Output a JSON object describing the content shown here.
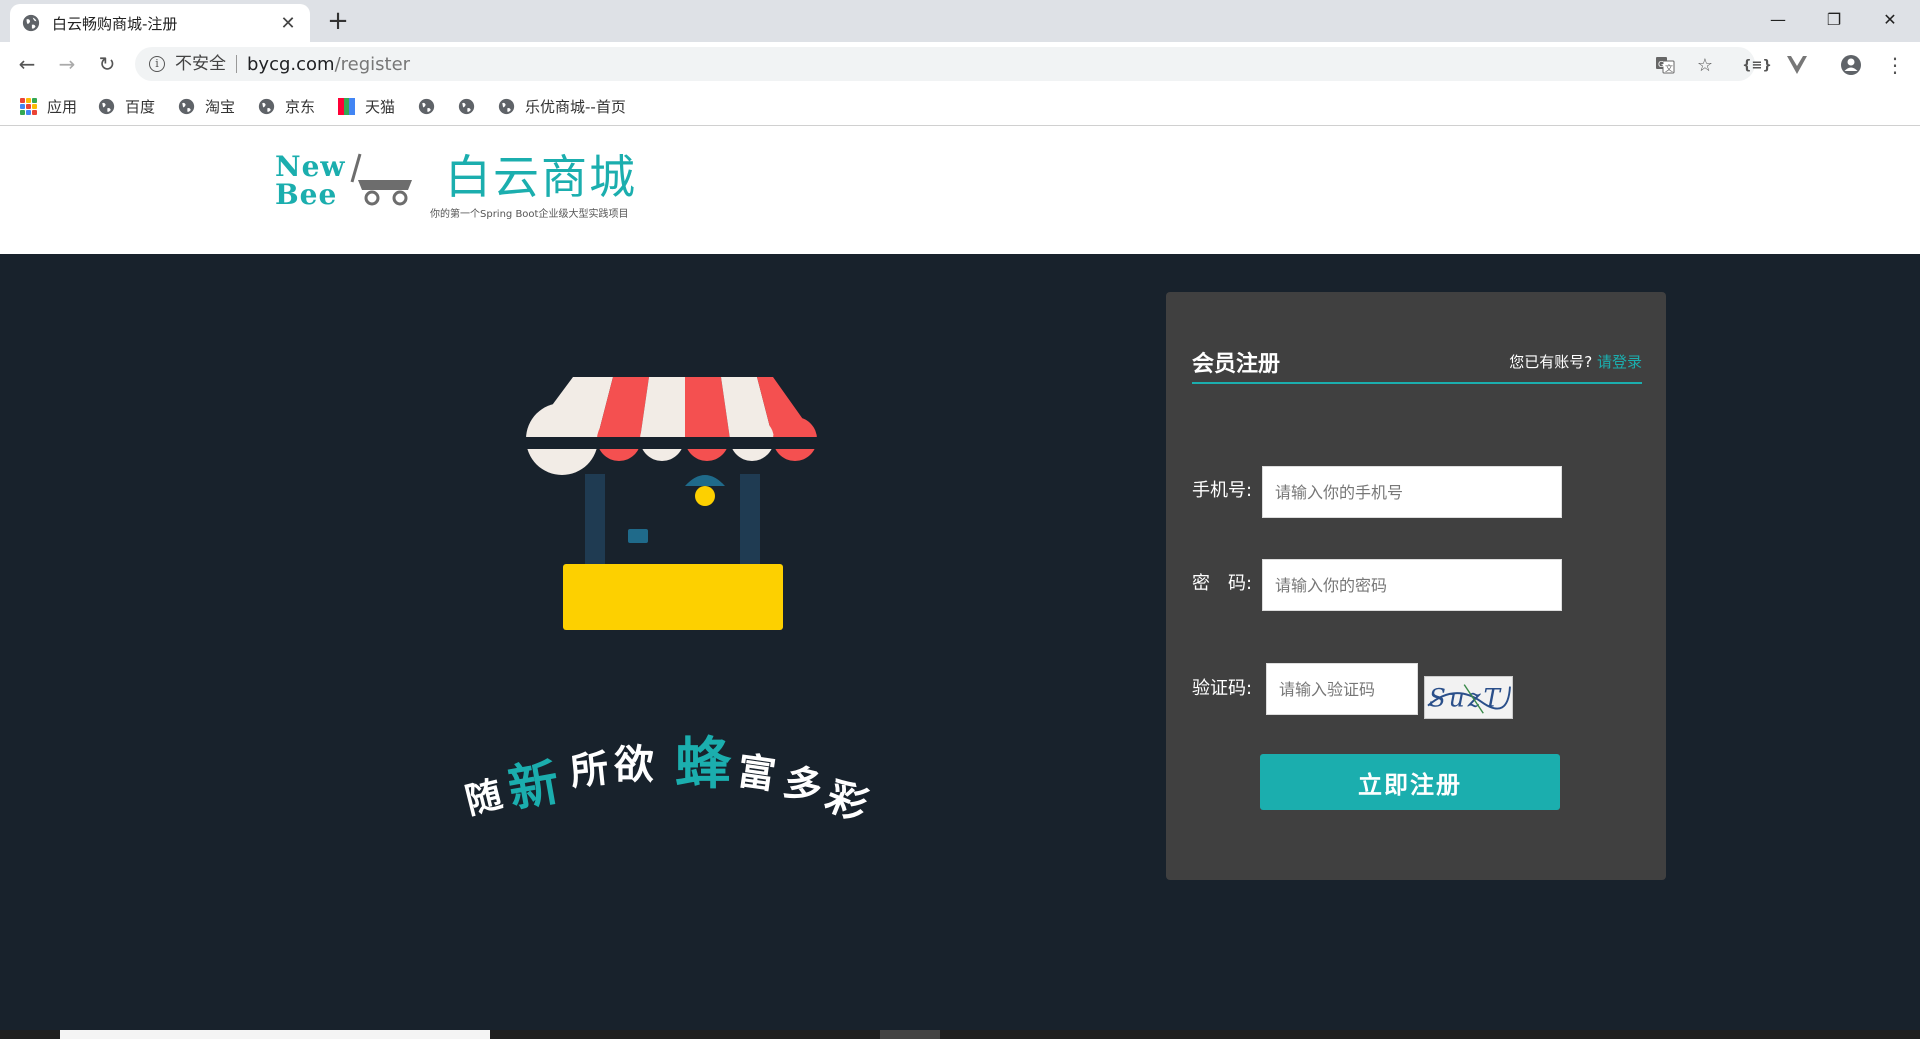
{
  "browser": {
    "tab_title": "白云畅购商城-注册",
    "tab_close": "✕",
    "new_tab": "+",
    "minimize": "—",
    "restore": "❐",
    "close": "✕"
  },
  "address_bar": {
    "security_label": "不安全",
    "host": "bycg.com",
    "path": "/register"
  },
  "bookmarks": [
    {
      "label": "应用",
      "icon": "apps-grid-icon"
    },
    {
      "label": "百度",
      "icon": "globe-icon"
    },
    {
      "label": "淘宝",
      "icon": "globe-icon"
    },
    {
      "label": "京东",
      "icon": "globe-icon"
    },
    {
      "label": "天猫",
      "icon": "tmall-icon"
    },
    {
      "label": "",
      "icon": "globe-icon"
    },
    {
      "label": "",
      "icon": "globe-icon"
    },
    {
      "label": "乐优商城--首页",
      "icon": "globe-icon"
    }
  ],
  "header": {
    "logo_line1": "New",
    "logo_line2": "Bee",
    "brand_name": "白云商城",
    "tagline": "你的第一个Spring Boot企业级大型实践项目"
  },
  "slogan": [
    "随",
    "新",
    "所",
    "欲",
    "蜂",
    "富",
    "多",
    "彩"
  ],
  "register": {
    "title": "会员注册",
    "has_account": "您已有账号?",
    "login_link": "请登录",
    "phone_label": "手机号:",
    "phone_placeholder": "请输入你的手机号",
    "password_label": "密　码:",
    "password_placeholder": "请输入你的密码",
    "captcha_label": "验证码:",
    "captcha_placeholder": "请输入验证码",
    "captcha_text": "SuzT",
    "submit_label": "立即注册"
  },
  "colors": {
    "accent": "#1baeae",
    "page_bg": "#18222c",
    "panel_bg": "#404040",
    "awning_red": "#f45050",
    "awning_cream": "#f2ece6",
    "counter_yellow": "#fdd000"
  }
}
